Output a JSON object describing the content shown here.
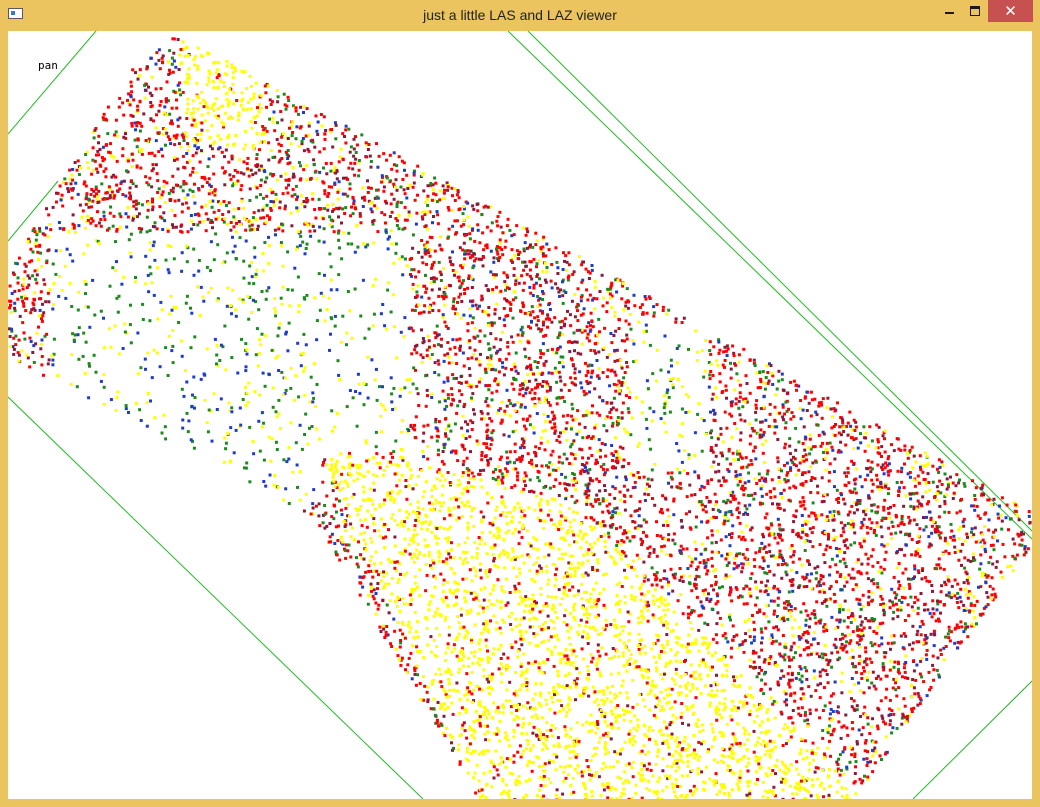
{
  "window": {
    "title": "just a little LAS and LAZ viewer",
    "icon": "app-window-icon",
    "controls": {
      "minimize_icon": "minimize-icon",
      "maximize_icon": "maximize-icon",
      "close_icon": "close-icon",
      "close_color": "#C75050"
    },
    "frame_color": "#EBC35F"
  },
  "viewer": {
    "mode_label": "pan",
    "background": "#FFFFFF",
    "bounding_box_color": "#22BB22",
    "point_colors": {
      "ground": "#FFFF00",
      "low": "#FF0000",
      "mid": "#8B1A3A",
      "green": "#1E8A1E",
      "blue": "#1E3CC8"
    }
  }
}
